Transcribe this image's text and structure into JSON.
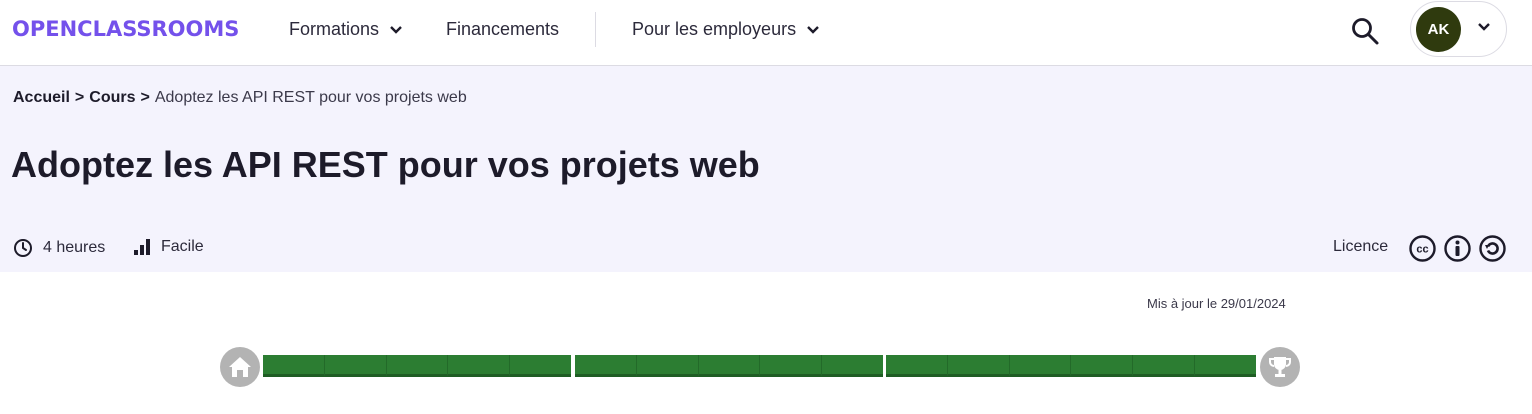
{
  "nav": {
    "logo": "OPENCLASSROOMS",
    "items": [
      {
        "label": "Formations",
        "has_dropdown": true
      },
      {
        "label": "Financements",
        "has_dropdown": false
      },
      {
        "label": "Pour les employeurs",
        "has_dropdown": true
      }
    ],
    "search_icon": "search-icon",
    "user": {
      "initials": "AK",
      "avatar_color": "#2f3a0e"
    }
  },
  "breadcrumb": {
    "items": [
      "Accueil",
      "Cours",
      "Adoptez les API REST pour vos projets web"
    ],
    "separator": ">"
  },
  "course": {
    "title": "Adoptez les API REST pour vos projets web",
    "duration": "4 heures",
    "difficulty": "Facile",
    "licence_label": "Licence",
    "licence_icons": [
      "cc-icon",
      "attribution-icon",
      "share-alike-icon"
    ],
    "updated": "Mis à jour le 29/01/2024"
  },
  "progress": {
    "parts": [
      {
        "steps": 5,
        "completed": 5
      },
      {
        "steps": 5,
        "completed": 5
      },
      {
        "steps": 6,
        "completed": 6
      }
    ],
    "start_icon": "home-icon",
    "end_icon": "trophy-icon",
    "completed_color": "#2c7d32"
  },
  "colors": {
    "brand": "#7451eb",
    "hero_bg": "#f4f3fd"
  }
}
